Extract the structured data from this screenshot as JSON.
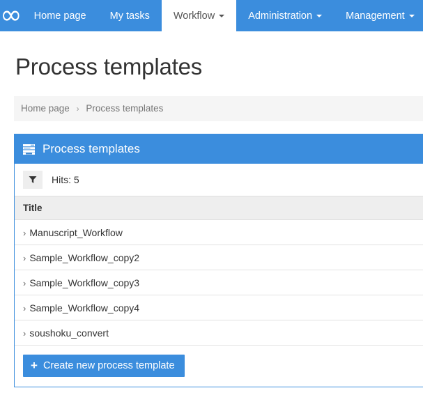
{
  "colors": {
    "brand_blue": "#3b8ddd",
    "panel_header_blue": "#3b8ddd",
    "breadcrumb_bg": "#f5f5f5",
    "table_header_bg": "#eeeeee",
    "text_dark": "#333333",
    "text_muted": "#777777"
  },
  "navbar": {
    "brand": {
      "icon": "infinity-logo-icon",
      "glyph": "∞"
    },
    "items": [
      {
        "label": "Home page",
        "has_caret": false,
        "active": false
      },
      {
        "label": "My tasks",
        "has_caret": false,
        "active": false
      },
      {
        "label": "Workflow",
        "has_caret": true,
        "active": true
      },
      {
        "label": "Administration",
        "has_caret": true,
        "active": false
      },
      {
        "label": "Management",
        "has_caret": true,
        "active": false
      }
    ]
  },
  "page": {
    "title": "Process templates"
  },
  "breadcrumb": {
    "items": [
      {
        "label": "Home page",
        "current": false
      },
      {
        "label": "Process templates",
        "current": true
      }
    ],
    "separator": "›"
  },
  "panel": {
    "icon": "list-table-icon",
    "title": "Process templates",
    "filter": {
      "icon": "funnel-filter-icon",
      "hits_label": "Hits: 5"
    },
    "table": {
      "columns": [
        "Title"
      ],
      "row_marker": "›",
      "rows": [
        {
          "title": "Manuscript_Workflow"
        },
        {
          "title": "Sample_Workflow_copy2"
        },
        {
          "title": "Sample_Workflow_copy3"
        },
        {
          "title": "Sample_Workflow_copy4"
        },
        {
          "title": "soushoku_convert"
        }
      ]
    },
    "footer": {
      "create_button_icon": "plus-icon",
      "create_button_plus": "+",
      "create_button_label": "Create new process template"
    }
  }
}
